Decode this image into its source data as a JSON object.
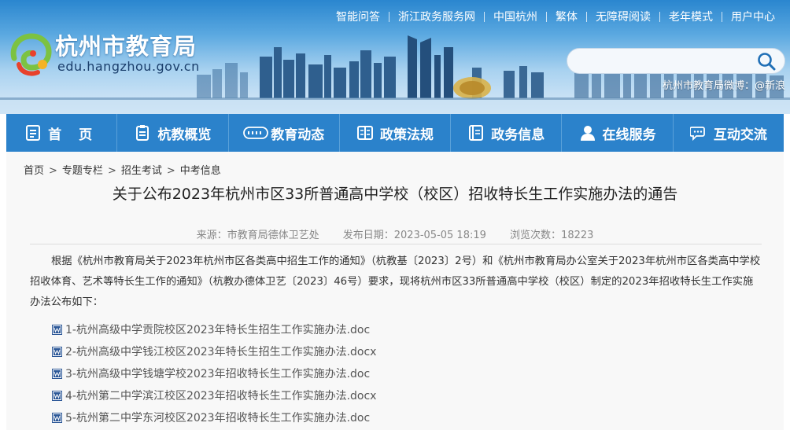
{
  "header": {
    "top_links": [
      "智能问答",
      "浙江政务服务网",
      "中国杭州",
      "繁体",
      "无障碍阅读",
      "老年模式",
      "用户中心"
    ],
    "site_title": "杭州市教育局",
    "site_domain": "edu.hangzhou.gov.cn",
    "search_placeholder": "",
    "weibo": "杭州市教育局微博：@新浪"
  },
  "nav": [
    {
      "label": "首 页",
      "icon": "home-doc-icon"
    },
    {
      "label": "杭教概览",
      "icon": "clipboard-icon"
    },
    {
      "label": "教育动态",
      "icon": "news-icon"
    },
    {
      "label": "政策法规",
      "icon": "document-icon"
    },
    {
      "label": "政务信息",
      "icon": "book-icon"
    },
    {
      "label": "在线服务",
      "icon": "user-icon"
    },
    {
      "label": "互动交流",
      "icon": "chat-icon"
    }
  ],
  "breadcrumb": [
    "首页",
    "专题专栏",
    "招生考试",
    "中考信息"
  ],
  "article": {
    "title": "关于公布2023年杭州市区33所普通高中学校（校区）招收特长生工作实施办法的通告",
    "source": "来源：市教育局德体卫艺处",
    "date": "发布日期：2023-05-05 18:19",
    "views": "浏览次数：18223",
    "paragraph": "根据《杭州市教育局关于2023年杭州市区各类高中招生工作的通知》（杭教基〔2023〕2号）和《杭州市教育局办公室关于2023年杭州市区各类高中学校招收体育、艺术等特长生工作的通知》（杭教办德体卫艺〔2023〕46号）要求，现将杭州市区33所普通高中学校（校区）制定的2023年招收特长生工作实施办法公布如下：",
    "attachments": [
      "1-杭州高级中学贡院校区2023年特长生招生工作实施办法.doc",
      "2-杭州高级中学钱江校区2023年特长生招生工作实施办法.docx",
      "3-杭州高级中学钱塘学校2023年招收特长生工作实施办法.doc",
      "4-杭州第二中学滨江校区2023年招收特长生工作实施办法.docx",
      "5-杭州第二中学东河校区2023年招收特长生工作实施办法.doc"
    ]
  },
  "colors": {
    "nav_bg": "#2b82cb",
    "header_top": "#2a86cf",
    "logo_green": "#7cc242",
    "logo_red": "#e8412c",
    "logo_yellow": "#f5b325"
  }
}
